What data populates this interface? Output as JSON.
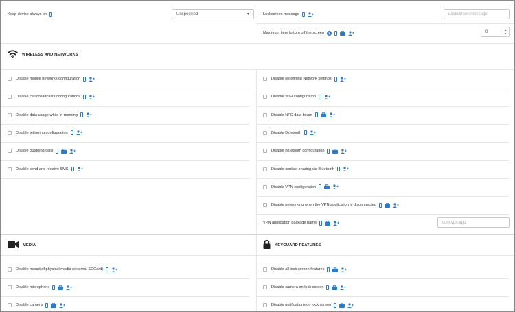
{
  "top": {
    "keep_label": "Keep device always on",
    "keep_value": "Unspecified",
    "lockscreen_label": "Lockscreen message",
    "lockscreen_placeholder": "Lockscreen message",
    "maxtime_label": "Maximum time to turn off the screen",
    "maxtime_value": "0"
  },
  "wireless": {
    "title": "WIRELESS AND NETWORKS",
    "left": [
      {
        "label": "Disable mobile networks configuration",
        "icons": [
          "phone",
          "user"
        ]
      },
      {
        "label": "Disable cell broadcasts configurations",
        "icons": [
          "phone",
          "user"
        ]
      },
      {
        "label": "Disable data usage while in roaming",
        "icons": [
          "phone",
          "user"
        ]
      },
      {
        "label": "Disable tethering configuration",
        "icons": [
          "phone",
          "user"
        ]
      },
      {
        "label": "Disable outgoing calls",
        "icons": [
          "phone",
          "briefcase",
          "user"
        ]
      },
      {
        "label": "Disable send and receive SMS",
        "icons": [
          "phone",
          "user"
        ]
      }
    ],
    "right": [
      {
        "label": "Disable redefining Network settings",
        "icons": [
          "phone",
          "user"
        ]
      },
      {
        "label": "Disable WiFi configuration",
        "icons": [
          "phone",
          "user"
        ]
      },
      {
        "label": "Disable NFC data beam",
        "icons": [
          "phone",
          "briefcase",
          "user"
        ]
      },
      {
        "label": "Disable Bluetooth",
        "icons": [
          "phone",
          "user"
        ]
      },
      {
        "label": "Disable Bluetooth configuration",
        "icons": [
          "phone",
          "briefcase",
          "user"
        ]
      },
      {
        "label": "Disable contact sharing via Bluetooth",
        "icons": [
          "phone",
          "user"
        ]
      },
      {
        "label": "Disable VPN configuration",
        "icons": [
          "phone",
          "briefcase",
          "user"
        ]
      },
      {
        "label": "Disable networking when the VPN application is disconnected",
        "icons": [
          "phone",
          "briefcase",
          "user"
        ]
      }
    ],
    "vpn_label": "VPN application package name",
    "vpn_placeholder": "com.vpn.app"
  },
  "media": {
    "title": "MEDIA",
    "items": [
      {
        "label": "Disable mount of physical media (external SDCard)",
        "icons": [
          "phone",
          "user"
        ]
      },
      {
        "label": "Disable microphone",
        "icons": [
          "phone",
          "briefcase",
          "user"
        ]
      },
      {
        "label": "Disable camera",
        "icons": [
          "phone",
          "briefcase",
          "user"
        ]
      }
    ]
  },
  "keyguard": {
    "title": "KEYGUARD FEATURES",
    "items": [
      {
        "label": "Disable all lock screen features",
        "icons": [
          "phone",
          "briefcase",
          "user"
        ]
      },
      {
        "label": "Disable camera on lock screen",
        "icons": [
          "phone",
          "briefcase",
          "user"
        ]
      },
      {
        "label": "Disable notifications on lock screen",
        "icons": [
          "phone",
          "briefcase",
          "user"
        ]
      }
    ]
  },
  "colors": {
    "accent": "#2e7bc4",
    "border": "#e6e6e6"
  }
}
